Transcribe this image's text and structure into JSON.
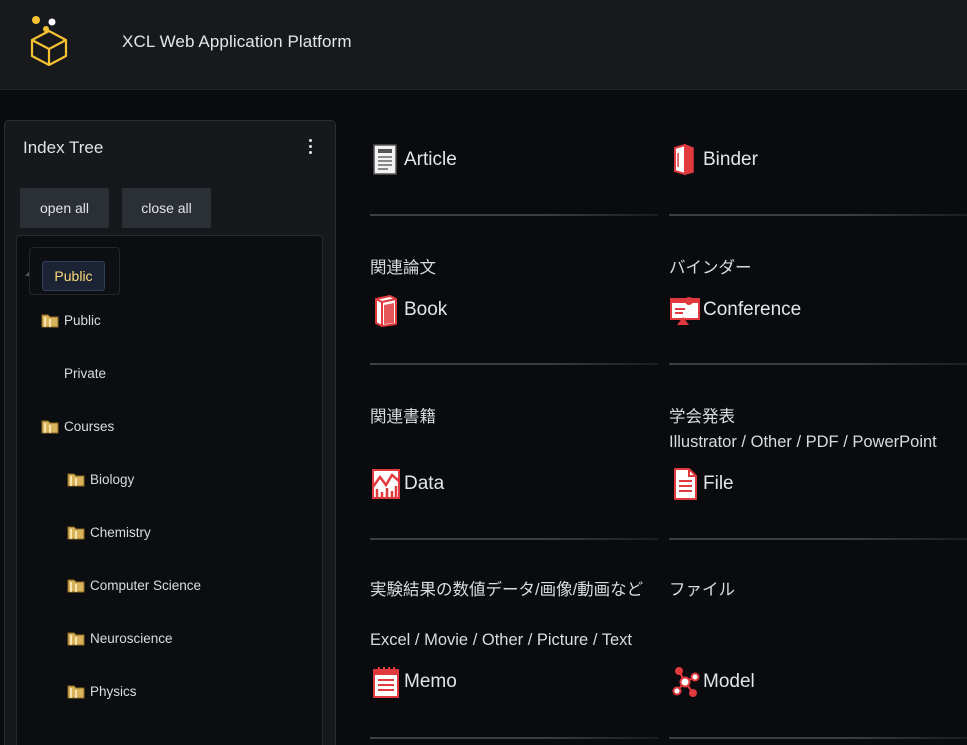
{
  "header": {
    "app_title": "XCL Web Application Platform",
    "logo_icon": "cube-dots-logo-icon"
  },
  "index_tree": {
    "title": "Index Tree",
    "open_all": "open all",
    "close_all": "close all",
    "tab": "Public",
    "items": [
      {
        "label": "Public"
      },
      {
        "label": "Private"
      },
      {
        "label": "Courses"
      },
      {
        "label": "Biology"
      },
      {
        "label": "Chemistry"
      },
      {
        "label": "Computer Science"
      },
      {
        "label": "Neuroscience"
      },
      {
        "label": "Physics"
      }
    ]
  },
  "item_types": [
    {
      "label": "Article",
      "icon": "article-icon",
      "description": "関連論文",
      "subtypes": ""
    },
    {
      "label": "Binder",
      "icon": "binder-icon",
      "description": "バインダー",
      "subtypes": ""
    },
    {
      "label": "Book",
      "icon": "book-icon",
      "description": "関連書籍",
      "subtypes": ""
    },
    {
      "label": "Conference",
      "icon": "conference-icon",
      "description": "学会発表",
      "subtypes": "Illustrator / Other / PDF / PowerPoint"
    },
    {
      "label": "Data",
      "icon": "data-icon",
      "description": "実験結果の数値データ/画像/動画など",
      "subtypes": "Excel / Movie / Other / Picture / Text"
    },
    {
      "label": "File",
      "icon": "file-icon",
      "description": "ファイル",
      "subtypes": ""
    },
    {
      "label": "Memo",
      "icon": "memo-icon",
      "description": "",
      "subtypes": ""
    },
    {
      "label": "Model",
      "icon": "model-icon",
      "description": "",
      "subtypes": ""
    }
  ],
  "colors": {
    "accent_icon": "#e0393e",
    "tab_text": "#ffd979",
    "background": "#0a0b0e",
    "header_bg": "#17191d"
  }
}
